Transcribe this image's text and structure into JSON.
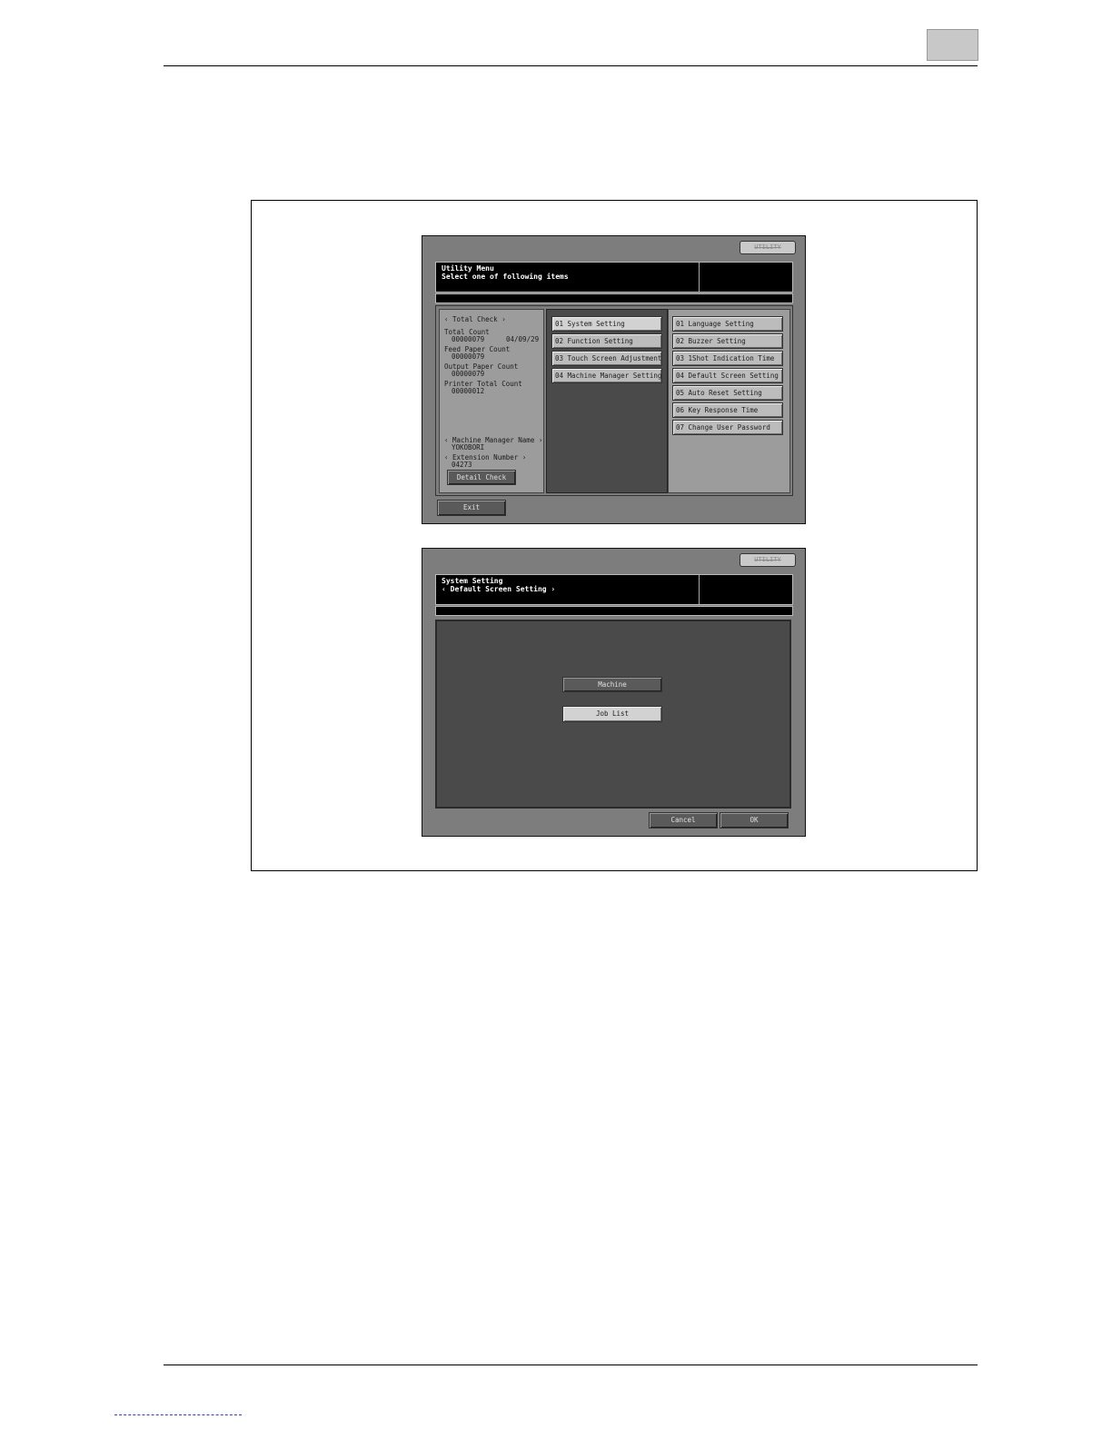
{
  "screen1": {
    "util_button": "UTILITY",
    "title_line1": "Utility Menu",
    "title_line2": "Select one of following items",
    "total_check": "‹ Total Check ›",
    "total_count_label": "Total Count",
    "total_count_value": "00000079",
    "date": "04/09/29",
    "feed_paper_label": "Feed Paper Count",
    "feed_paper_value": "00000079",
    "output_paper_label": "Output Paper Count",
    "output_paper_value": "00000079",
    "printer_total_label": "Printer Total Count",
    "printer_total_value": "00000012",
    "manager_name_label": "‹ Machine Manager Name ›",
    "manager_name_value": "YOKOBORI",
    "extension_label": "‹ Extension Number ›",
    "extension_value": "04273",
    "detail_check": "Detail Check",
    "exit": "Exit",
    "middle_items": [
      "01 System Setting",
      "02 Function Setting",
      "03 Touch Screen Adjustment",
      "04 Machine Manager Setting"
    ],
    "right_items": [
      "01 Language Setting",
      "02 Buzzer Setting",
      "03 1Shot Indication Time",
      "04 Default Screen Setting",
      "05 Auto Reset Setting",
      "06 Key Response Time",
      "07 Change User Password"
    ]
  },
  "screen2": {
    "util_button": "UTILITY",
    "title_line1": "System Setting",
    "title_line2": "‹ Default Screen Setting ›",
    "machine": "Machine",
    "job_list": "Job List",
    "cancel": "Cancel",
    "ok": "OK"
  }
}
